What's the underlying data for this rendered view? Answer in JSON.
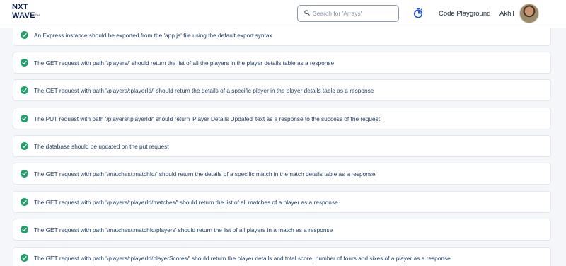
{
  "header": {
    "logo_line1": "NXT",
    "logo_line2": "WAVE",
    "logo_tm": "TM",
    "search_placeholder": "Search for 'Arrays'",
    "timer_icon": "stopwatch-icon",
    "code_playground_label": "Code Playground",
    "user_name": "Akhil"
  },
  "colors": {
    "check": "#22a06b",
    "card_text": "#1e3a5f",
    "background": "#f4f6f9",
    "logo": "#0b1e4f"
  },
  "test_cases": [
    {
      "text": "An Express instance should be exported from the 'app.js' file using the default export syntax",
      "status": "passed"
    },
    {
      "text": "The GET request with path '/players/' should return the list of all the players in the player details table as a response",
      "status": "passed"
    },
    {
      "text": "The GET request with path '/players/:playerId/' should return the details of a specific player in the player details table as a response",
      "status": "passed"
    },
    {
      "text": "The PUT request with path '/players/:playerId/' should return 'Player Details Updated' text as a response to the success of the request",
      "status": "passed"
    },
    {
      "text": "The database should be updated on the put request",
      "status": "passed"
    },
    {
      "text": "The GET request with path '/matches/:matchId/' should return the details of a specific match in the natch details table as a response",
      "status": "passed"
    },
    {
      "text": "The GET request with path '/players/:playerId/matches/' should return the list of all matches of a player as a response",
      "status": "passed"
    },
    {
      "text": "The GET request with path '/matches/:matchId/players' should return the list of all players in a match as a response",
      "status": "passed"
    },
    {
      "text": "The GET request with path '/players/:playerId/playerScores/' should return the player details and total score, number of fours and sixes of a player as a response",
      "status": "passed"
    }
  ]
}
